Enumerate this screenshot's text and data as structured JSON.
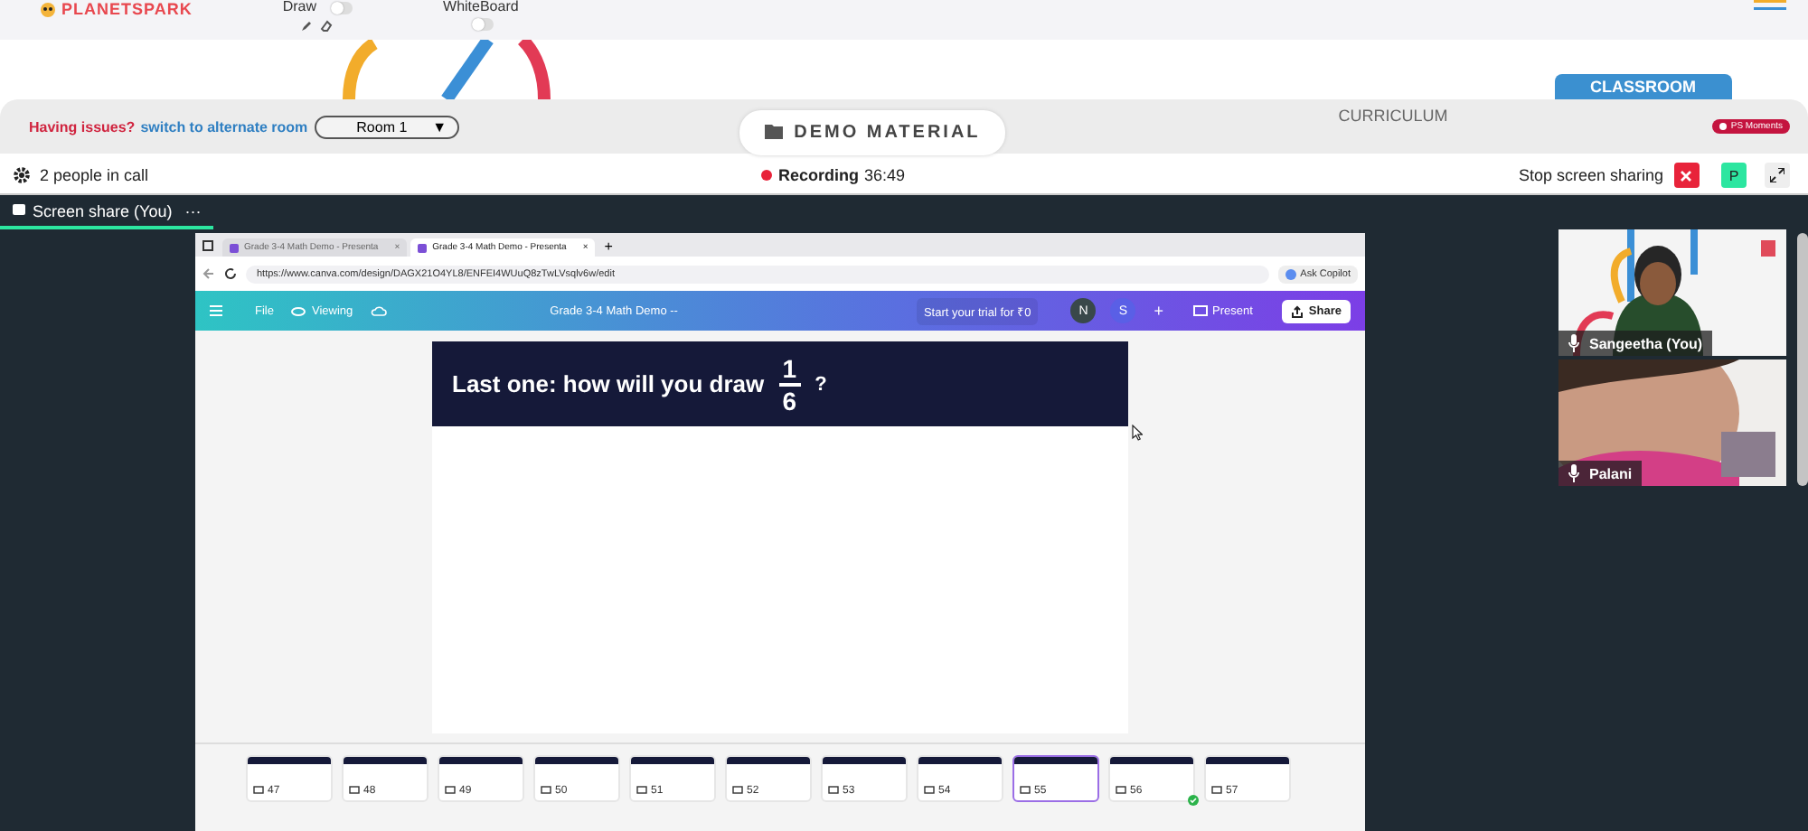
{
  "header": {
    "logo": "PLANETSPARK",
    "draw_label": "Draw",
    "draw_on": false,
    "whiteboard_label": "WhiteBoard",
    "whiteboard_on": false
  },
  "room_bar": {
    "issue_text": "Having issues?",
    "switch_link": "switch to alternate room",
    "room": "Room 1",
    "caret": "▼",
    "demo_button": "DEMO MATERIAL",
    "tabs": [
      {
        "label": "CURRICULUM",
        "selected": false
      },
      {
        "label": "CLASSROOM",
        "selected": true
      }
    ],
    "badge": "PS Moments"
  },
  "call_bar": {
    "people": "2 people in call",
    "recording_label": "Recording",
    "recording_time": "36:49",
    "stop_sharing": "Stop screen sharing",
    "avatar": "P"
  },
  "stage_tab": {
    "label": "Screen share (You)",
    "menu": "···"
  },
  "browser": {
    "tabs": [
      {
        "title": "Grade 3-4 Math Demo - Presenta",
        "close": "×",
        "selected": false
      },
      {
        "title": "Grade 3-4 Math Demo - Presenta",
        "close": "×",
        "selected": true
      }
    ],
    "new_tab": "+",
    "url": "https://www.canva.com/design/DAGX21O4YL8/ENFEI4WUuQ8zTwLVsqlv6w/edit",
    "copilot": "Ask Copilot"
  },
  "canva": {
    "file": "File",
    "viewing": "Viewing",
    "title": "Grade 3-4 Math Demo --",
    "trial": "Start your trial for ₹0",
    "collaborators": [
      "N",
      "S"
    ],
    "add": "+",
    "present": "Present",
    "share": "Share"
  },
  "slide": {
    "question": "Last one: how will you draw",
    "numerator": "1",
    "denominator": "6",
    "end": "?"
  },
  "thumbnails": [
    {
      "number": "47",
      "selected": false,
      "done": false
    },
    {
      "number": "48",
      "selected": false,
      "done": false
    },
    {
      "number": "49",
      "selected": false,
      "done": false
    },
    {
      "number": "50",
      "selected": false,
      "done": false
    },
    {
      "number": "51",
      "selected": false,
      "done": false
    },
    {
      "number": "52",
      "selected": false,
      "done": false
    },
    {
      "number": "53",
      "selected": false,
      "done": false
    },
    {
      "number": "54",
      "selected": false,
      "done": false
    },
    {
      "number": "55",
      "selected": true,
      "done": false
    },
    {
      "number": "56",
      "selected": false,
      "done": true
    },
    {
      "number": "57",
      "selected": false,
      "done": false
    }
  ],
  "participants": [
    {
      "name": "Sangeetha (You)"
    },
    {
      "name": "Palani"
    }
  ]
}
